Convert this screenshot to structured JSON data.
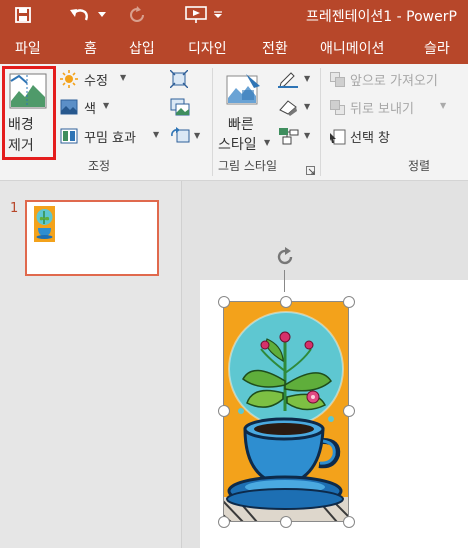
{
  "window": {
    "title": "프레젠테이션1 - PowerP"
  },
  "tabs": [
    {
      "label": "파일"
    },
    {
      "label": "홈"
    },
    {
      "label": "삽입"
    },
    {
      "label": "디자인"
    },
    {
      "label": "전환"
    },
    {
      "label": "애니메이션"
    },
    {
      "label": "슬라"
    }
  ],
  "ribbon": {
    "adjust": {
      "remove_bg": {
        "line1": "배경",
        "line2": "제거"
      },
      "corrections": "수정",
      "color": "색",
      "artistic": "꾸밈 효과",
      "group_label": "조정"
    },
    "styles": {
      "quick": {
        "line1": "빠른",
        "line2": "스타일"
      },
      "group_label": "그림 스타일"
    },
    "arrange": {
      "bring_forward": "앞으로 가져오기",
      "send_backward": "뒤로 보내기",
      "selection_pane": "선택 창",
      "group_label": "정렬"
    }
  },
  "slides": [
    {
      "number": "1"
    }
  ],
  "colors": {
    "accent": "#b7472a",
    "highlight": "#e41d1d",
    "thumb_border": "#e0694d"
  }
}
